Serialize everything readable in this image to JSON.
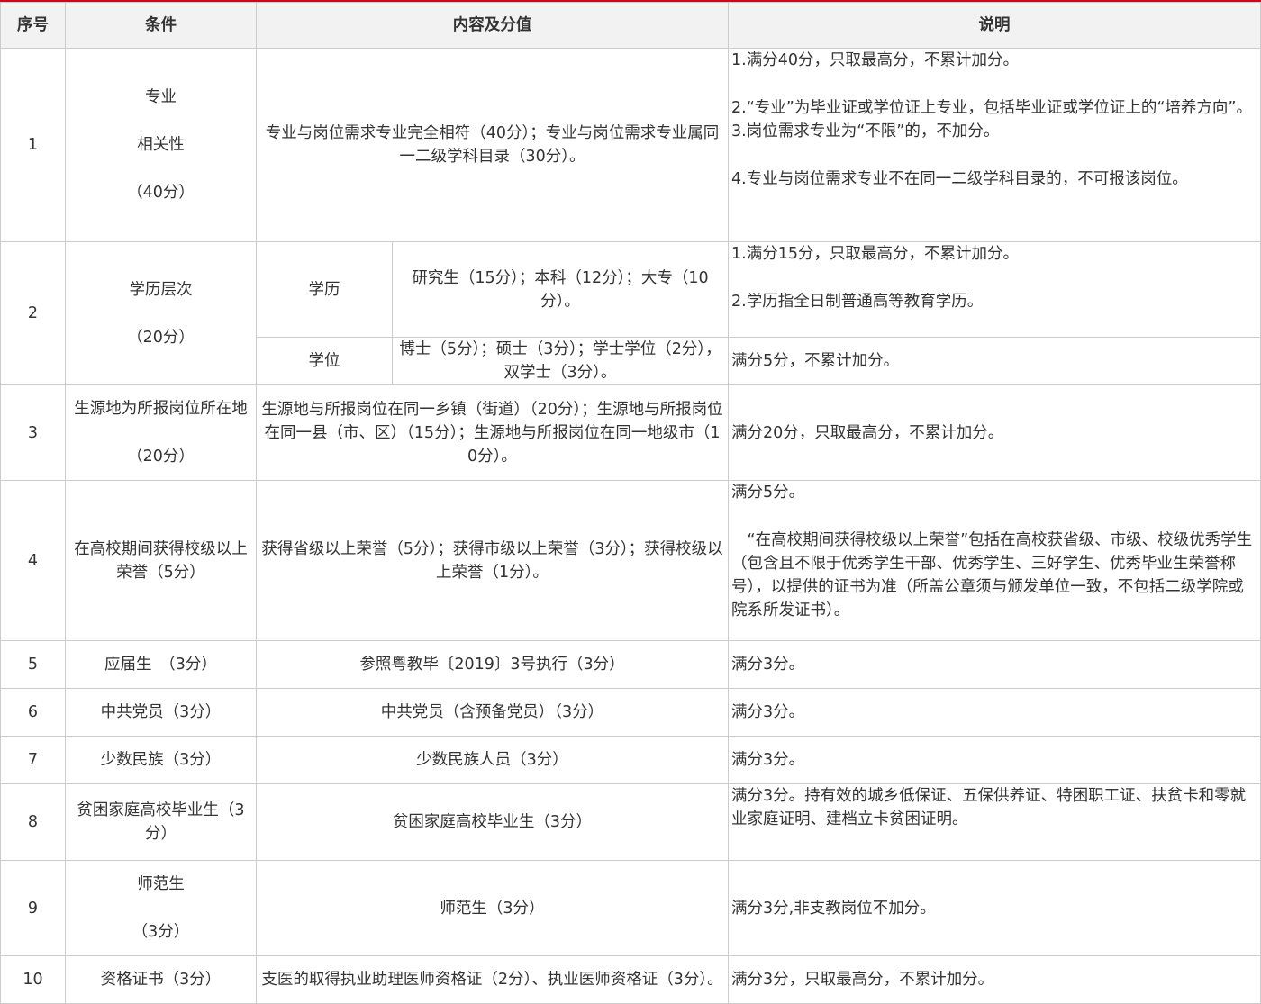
{
  "headers": {
    "no": "序号",
    "condition": "条件",
    "content": "内容及分值",
    "note": "说明"
  },
  "rows": {
    "r1": {
      "no": "1",
      "cond": [
        "专业",
        "相关性",
        "（40分）"
      ],
      "content": "专业与岗位需求专业完全相符（40分）；专业与岗位需求专业属同一二级学科目录（30分）。",
      "note": [
        "1.满分40分，只取最高分，不累计加分。",
        "2.“专业”为毕业证或学位证上专业，包括毕业证或学位证上的“培养方向”。",
        "3.岗位需求专业为“不限”的，不加分。",
        "4.专业与岗位需求专业不在同一二级学科目录的，不可报该岗位。"
      ]
    },
    "r2": {
      "no": "2",
      "cond": [
        "学历层次",
        "（20分）"
      ],
      "edu_label": "学历",
      "edu_content": "研究生（15分）；本科（12分）；大专（10分）。",
      "edu_note": [
        "1.满分15分，只取最高分，不累计加分。",
        "2.学历指全日制普通高等教育学历。"
      ],
      "deg_label": "学位",
      "deg_content": "博士（5分）；硕士（3分）；学士学位（2分），双学士（3分）。",
      "deg_note": "满分5分，不累计加分。"
    },
    "r3": {
      "no": "3",
      "cond": [
        "生源地为所报岗位所在地",
        "（20分）"
      ],
      "content": "生源地与所报岗位在同一乡镇（街道）（20分）；生源地与所报岗位在同一县（市、区）（15分）；生源地与所报岗位在同一地级市（10分）。",
      "note": "满分20分，只取最高分，不累计加分。"
    },
    "r4": {
      "no": "4",
      "cond": "在高校期间获得校级以上荣誉（5分）",
      "content": "获得省级以上荣誉（5分）；获得市级以上荣誉（3分）；获得校级以上荣誉（1分）。",
      "note": [
        "满分5分。",
        "“在高校期间获得校级以上荣誉”包括在高校获省级、市级、校级优秀学生（包含且不限于优秀学生干部、优秀学生、三好学生、优秀毕业生荣誉称号），以提供的证书为准（所盖公章须与颁发单位一致，不包括二级学院或院系所发证书）。"
      ]
    },
    "r5": {
      "no": "5",
      "cond": "应届生　（3分）",
      "content": "参照粤教毕〔2019〕3号执行（3分）",
      "note": "满分3分。"
    },
    "r6": {
      "no": "6",
      "cond": "中共党员（3分）",
      "content": "中共党员（含预备党员）（3分）",
      "note": "满分3分。"
    },
    "r7": {
      "no": "7",
      "cond": "少数民族（3分）",
      "content": "少数民族人员（3分）",
      "note": "满分3分。"
    },
    "r8": {
      "no": "8",
      "cond": "贫困家庭高校毕业生（3分）",
      "content": "贫困家庭高校毕业生（3分）",
      "note": "满分3分。持有效的城乡低保证、五保供养证、特困职工证、扶贫卡和零就业家庭证明、建档立卡贫困证明。"
    },
    "r9": {
      "no": "9",
      "cond": [
        "师范生",
        "（3分）"
      ],
      "content": "师范生（3分）",
      "note": "满分3分,非支教岗位不加分。"
    },
    "r10": {
      "no": "10",
      "cond": "资格证书（3分）",
      "content": "支医的取得执业助理医师资格证（2分）、执业医师资格证（3分）。",
      "note": "满分3分，只取最高分，不累计加分。"
    }
  }
}
